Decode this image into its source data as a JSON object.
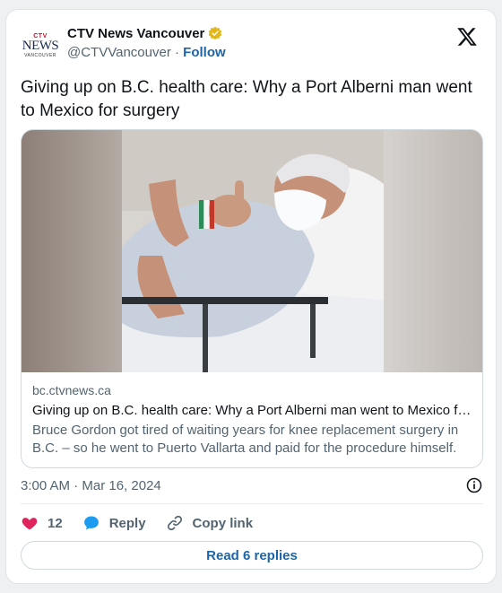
{
  "account": {
    "display_name": "CTV News Vancouver",
    "handle": "@CTVVancouver",
    "separator": "·",
    "follow_label": "Follow",
    "logo": {
      "ctv": "CTV",
      "news": "NEWS",
      "city": "VANCOUVER"
    }
  },
  "tweet": {
    "text": "Giving up on B.C. health care: Why a Port Alberni man went to Mexico for surgery"
  },
  "link_card": {
    "domain": "bc.ctvnews.ca",
    "title": "Giving up on B.C. health care: Why a Port Alberni man went to Mexico for surgery",
    "description": "Bruce Gordon got tired of waiting years for knee replacement surgery in B.C. – so he went to Puerto Vallarta and paid for the procedure himself."
  },
  "meta": {
    "timestamp": "3:00 AM · Mar 16, 2024"
  },
  "actions": {
    "likes_count": "12",
    "reply_label": "Reply",
    "copy_link_label": "Copy link"
  },
  "read_replies_label": "Read 6 replies",
  "colors": {
    "accent": "#1d65a8",
    "like": "#e0245e",
    "reply": "#1d9bf0",
    "verified_gold": "#e2b719"
  }
}
